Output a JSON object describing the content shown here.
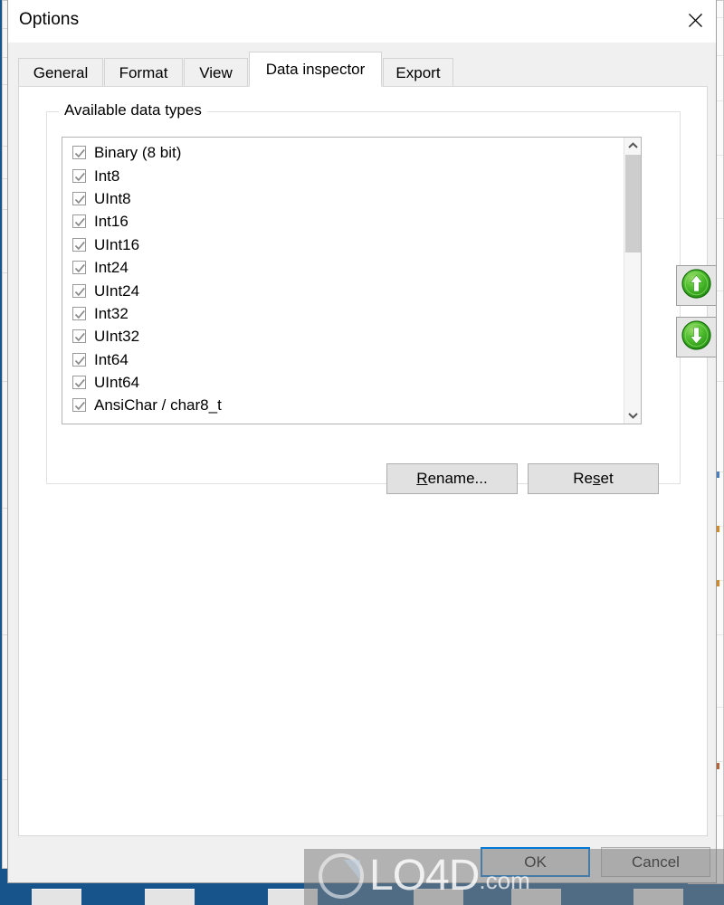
{
  "window": {
    "title": "Options",
    "close_icon": "close-icon"
  },
  "tabs": [
    {
      "label": "General",
      "selected": false
    },
    {
      "label": "Format",
      "selected": false
    },
    {
      "label": "View",
      "selected": false
    },
    {
      "label": "Data inspector",
      "selected": true
    },
    {
      "label": "Export",
      "selected": false
    }
  ],
  "groupbox": {
    "label": "Available data types"
  },
  "data_types": [
    {
      "label": "Binary (8 bit)",
      "checked": true
    },
    {
      "label": "Int8",
      "checked": true
    },
    {
      "label": "UInt8",
      "checked": true
    },
    {
      "label": "Int16",
      "checked": true
    },
    {
      "label": "UInt16",
      "checked": true
    },
    {
      "label": "Int24",
      "checked": true
    },
    {
      "label": "UInt24",
      "checked": true
    },
    {
      "label": "Int32",
      "checked": true
    },
    {
      "label": "UInt32",
      "checked": true
    },
    {
      "label": "Int64",
      "checked": true
    },
    {
      "label": "UInt64",
      "checked": true
    },
    {
      "label": "AnsiChar / char8_t",
      "checked": true
    }
  ],
  "list_buttons": {
    "move_up_icon": "arrow-up-circle-icon",
    "move_down_icon": "arrow-down-circle-icon"
  },
  "scrollbar": {
    "up_icon": "chevron-up-icon",
    "down_icon": "chevron-down-icon"
  },
  "buttons": {
    "rename": {
      "accel": "R",
      "rest": "ename..."
    },
    "reset": {
      "pre": "Re",
      "accel": "s",
      "post": "et"
    },
    "ok": "OK",
    "cancel": "Cancel"
  },
  "watermark": {
    "text": "LO4D",
    "suffix": ".com"
  },
  "colors": {
    "accent_focus": "#0078d7",
    "desktop": "#17548c",
    "dialog_face": "#f0f0f0",
    "button_face": "#e1e1e1",
    "move_button_green": "#3fae29"
  }
}
